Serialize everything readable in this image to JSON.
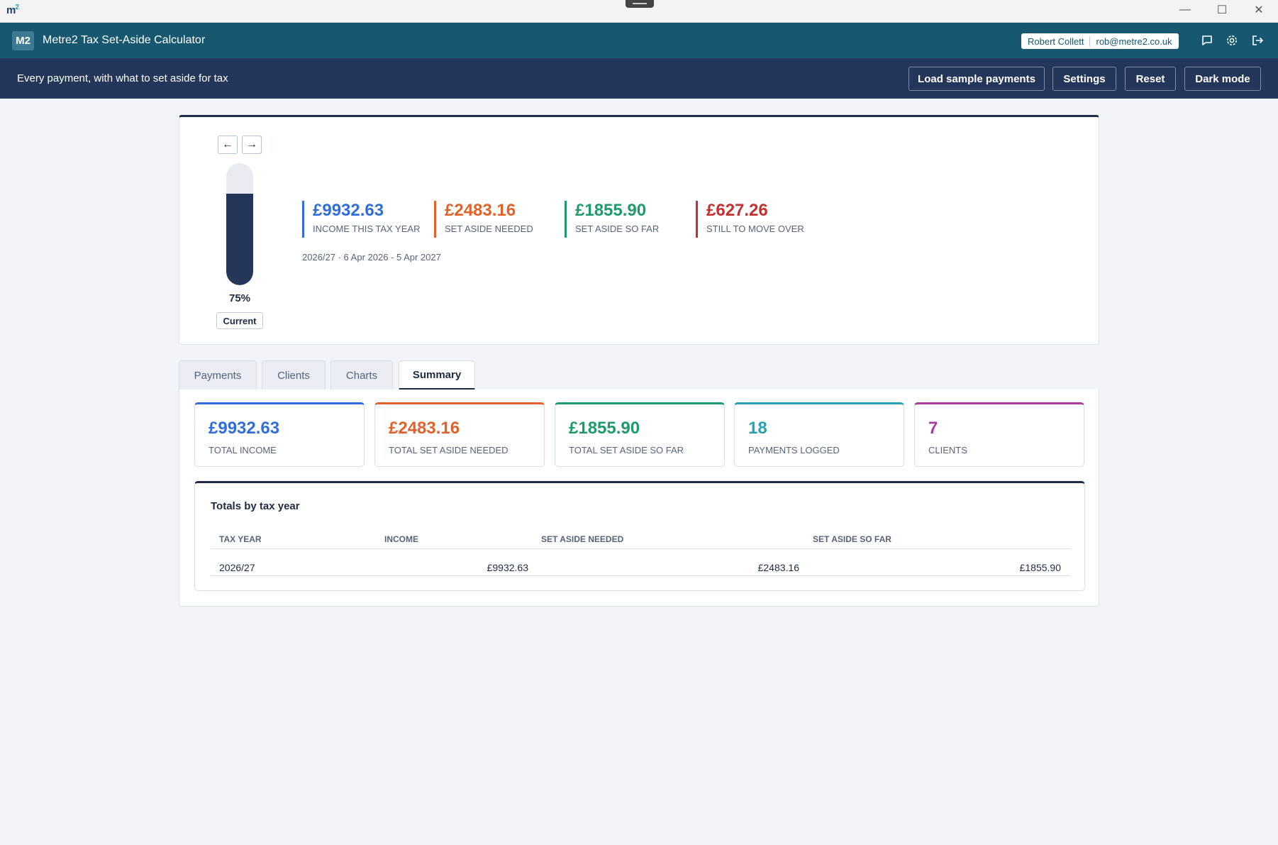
{
  "os": {
    "logo": "m",
    "logo_sup": "2",
    "minimize": "—",
    "maximize": "☐",
    "close": "✕"
  },
  "header": {
    "badge": "M2",
    "title": "Metre2 Tax Set-Aside Calculator",
    "user_name": "Robert Collett",
    "user_email": "rob@metre2.co.uk"
  },
  "subheader": {
    "tagline": "Every payment, with what to set aside for tax",
    "buttons": [
      "Load sample payments",
      "Settings",
      "Reset",
      "Dark mode"
    ]
  },
  "hero": {
    "prev": "←",
    "next": "→",
    "jar_fill_fraction": 0.75,
    "jar_percent": "75%",
    "current_label": "Current",
    "stats": [
      {
        "value": "£9932.63",
        "label": "Income this tax year",
        "color": "#2f6ed8"
      },
      {
        "value": "£2483.16",
        "label": "Set aside needed",
        "color": "#e0622a"
      },
      {
        "value": "£1855.90",
        "label": "Set aside so far",
        "color": "#1f9a6a"
      },
      {
        "value": "£627.26",
        "label": "Still to move over",
        "color": "#c62f2f"
      }
    ],
    "date_range": "2026/27 · 6 Apr 2026 - 5 Apr 2027"
  },
  "tabs": [
    "Payments",
    "Clients",
    "Charts",
    "Summary"
  ],
  "active_tab": "Summary",
  "summary": {
    "kpis": [
      {
        "value": "£9932.63",
        "label": "Total income",
        "color": "#2f6ed8"
      },
      {
        "value": "£2483.16",
        "label": "Total set aside needed",
        "color": "#e0622a"
      },
      {
        "value": "£1855.90",
        "label": "Total set aside so far",
        "color": "#1f9a6a"
      },
      {
        "value": "18",
        "label": "Payments logged",
        "color": "#2a9fb8"
      },
      {
        "value": "7",
        "label": "Clients",
        "color": "#a83ca0"
      }
    ],
    "totals_title": "Totals by tax year",
    "columns": [
      "Tax year",
      "Income",
      "Set aside needed",
      "Set aside so far"
    ],
    "rows": [
      {
        "tax_year": "2026/27",
        "income": "£9932.63",
        "needed": "£2483.16",
        "so_far": "£1855.90"
      }
    ]
  }
}
